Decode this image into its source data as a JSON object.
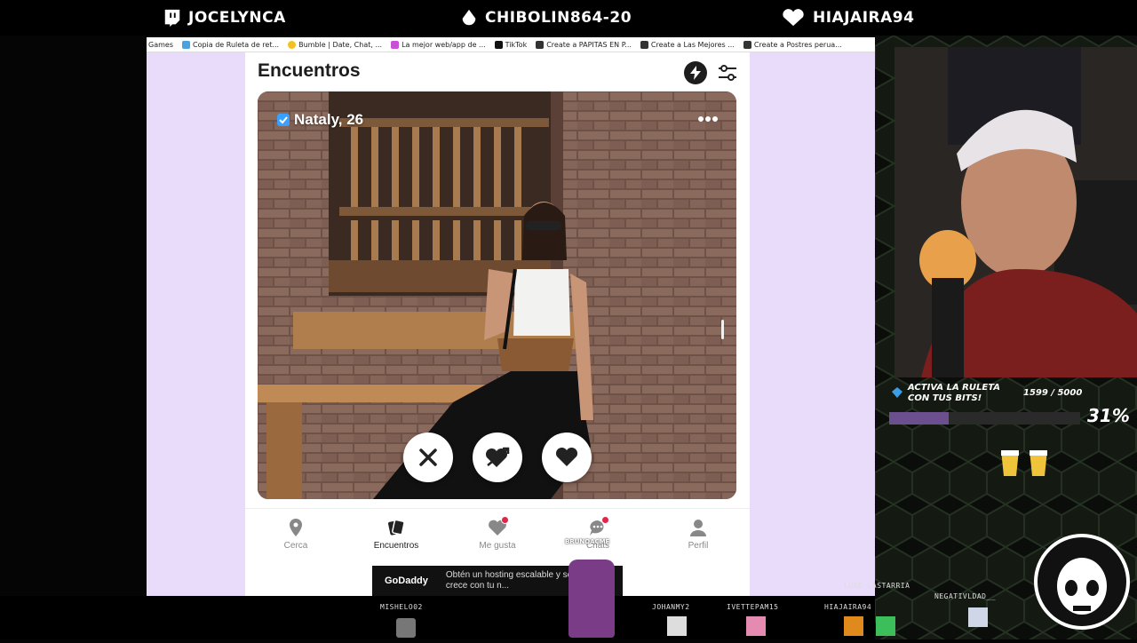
{
  "top_bar": {
    "items": [
      {
        "label": "JOCELYNCA",
        "icon": "twitch-icon"
      },
      {
        "label": "CHIBOLIN864-20",
        "icon": "bits-drop-icon"
      },
      {
        "label": "HIAJAIRA94",
        "icon": "heart-icon"
      }
    ]
  },
  "bookmarks": [
    {
      "label": "Games",
      "color": ""
    },
    {
      "label": "Copia de Ruleta de ret...",
      "color": "#4aa3df"
    },
    {
      "label": "Bumble | Date, Chat, ...",
      "color": "#f4c01e"
    },
    {
      "label": "La mejor web/app de ...",
      "color": "#c94fd8"
    },
    {
      "label": "TikTok",
      "color": "#111111"
    },
    {
      "label": "Create a PAPITAS EN P...",
      "color": "#333333"
    },
    {
      "label": "Create a Las Mejores ...",
      "color": "#333333"
    },
    {
      "label": "Create a Postres perua...",
      "color": "#333333"
    }
  ],
  "app": {
    "title": "Encuentros",
    "profile": {
      "name_age": "Nataly, 26",
      "verified": true
    },
    "nav": [
      {
        "label": "Cerca",
        "icon": "location-pin-icon",
        "dot": false,
        "active": false
      },
      {
        "label": "Encuentros",
        "icon": "cards-icon",
        "dot": false,
        "active": true
      },
      {
        "label": "Me gusta",
        "icon": "heart-icon",
        "dot": true,
        "active": false
      },
      {
        "label": "Chats",
        "icon": "chat-bubble-icon",
        "dot": true,
        "active": false
      },
      {
        "label": "Perfil",
        "icon": "user-icon",
        "dot": false,
        "active": false
      }
    ],
    "chat_overlay": "BRUNOACME"
  },
  "ad": {
    "brand": "GoDaddy",
    "text": "Obtén un hosting escalable y seguro que crece con tu n..."
  },
  "bits_widget": {
    "label": "ACTIVA LA RULETA CON TUS BITS!",
    "count": "1599 / 5000",
    "percent_text": "31%",
    "progress": 0.31
  },
  "viewers": [
    {
      "name": "MISHELO02"
    },
    {
      "name": "JOHANMY2"
    },
    {
      "name": "IVETTEPAM15"
    },
    {
      "name": "HIAJAIRA94"
    },
    {
      "name": "NEGATIVLDAD__"
    },
    {
      "name": "LUXE_LASTARRIA"
    }
  ],
  "colors": {
    "accent_purple": "#e9dcfb",
    "bits_fill": "#6b4f8f",
    "notification_dot": "#e0264b"
  }
}
